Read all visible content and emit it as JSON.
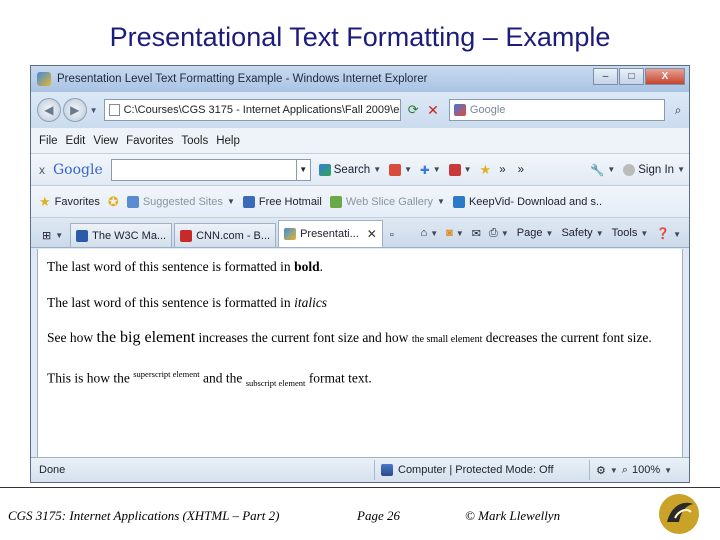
{
  "slide": {
    "title": "Presentational Text Formatting – Example"
  },
  "window": {
    "title": "Presentation Level Text Formatting Example - Windows Internet Explorer",
    "controls": {
      "minimize": "–",
      "maximize": "□",
      "close": "X"
    }
  },
  "address": {
    "url": "C:\\Courses\\CGS 3175 - Internet Applications\\Fall 2009\\e",
    "search_placeholder": "Google"
  },
  "menu": [
    "File",
    "Edit",
    "View",
    "Favorites",
    "Tools",
    "Help"
  ],
  "google_toolbar": {
    "close": "x",
    "logo": "Google",
    "search_label": "Search",
    "more": "»",
    "more2": "»",
    "sign_in": "Sign In"
  },
  "favorites_bar": {
    "favorites_label": "Favorites",
    "links": [
      "Suggested Sites",
      "Free Hotmail",
      "Web Slice Gallery",
      "KeepVid- Download and s.."
    ]
  },
  "tabs": [
    {
      "label": "The W3C Ma..."
    },
    {
      "label": "CNN.com - B..."
    },
    {
      "label": "Presentati..."
    }
  ],
  "tab_tools": [
    "Page",
    "Safety",
    "Tools"
  ],
  "content": {
    "line1_pre": "The last word of this sentence is formatted in ",
    "line1_bold": "bold",
    "line1_post": ".",
    "line2_pre": "The last word of this sentence is formatted in ",
    "line2_italic": "italics",
    "line3_a": "See how ",
    "line3_big": "the big element",
    "line3_b": " increases the current font size and how ",
    "line3_small": "the small element",
    "line3_c": " decreases the current font size.",
    "line4_a": "This is how the ",
    "line4_sup": "superscript element",
    "line4_b": " and the ",
    "line4_sub": "subscript element",
    "line4_c": " format text."
  },
  "status": {
    "left": "Done",
    "zone": "Computer | Protected Mode: Off",
    "zoom": "100%"
  },
  "footer": {
    "course": "CGS 3175: Internet Applications (XHTML – Part 2)",
    "page": "Page 26",
    "author": "© Mark Llewellyn"
  }
}
